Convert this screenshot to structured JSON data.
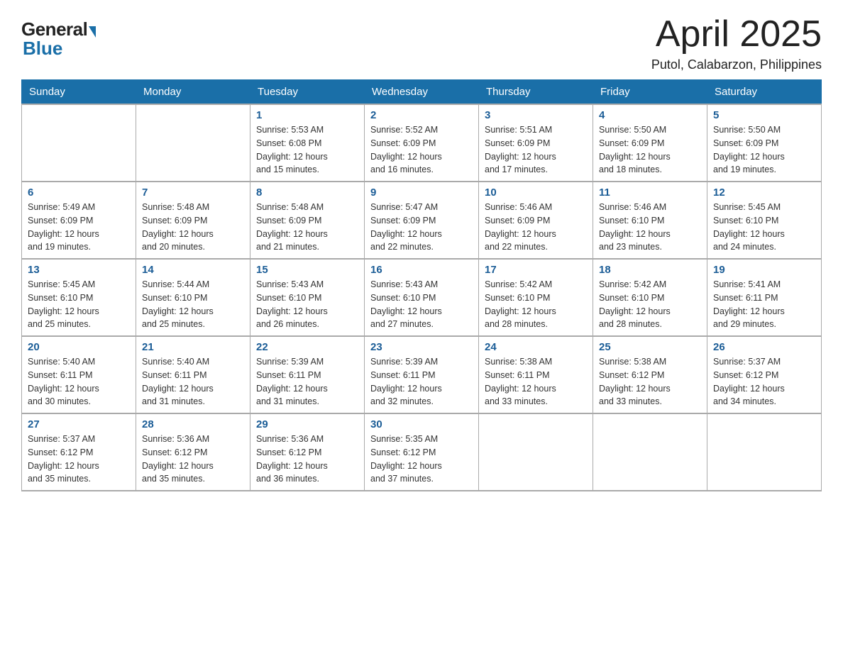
{
  "header": {
    "logo_general": "General",
    "logo_blue": "Blue",
    "month_title": "April 2025",
    "location": "Putol, Calabarzon, Philippines"
  },
  "weekdays": [
    "Sunday",
    "Monday",
    "Tuesday",
    "Wednesday",
    "Thursday",
    "Friday",
    "Saturday"
  ],
  "weeks": [
    [
      {
        "day": "",
        "info": ""
      },
      {
        "day": "",
        "info": ""
      },
      {
        "day": "1",
        "info": "Sunrise: 5:53 AM\nSunset: 6:08 PM\nDaylight: 12 hours\nand 15 minutes."
      },
      {
        "day": "2",
        "info": "Sunrise: 5:52 AM\nSunset: 6:09 PM\nDaylight: 12 hours\nand 16 minutes."
      },
      {
        "day": "3",
        "info": "Sunrise: 5:51 AM\nSunset: 6:09 PM\nDaylight: 12 hours\nand 17 minutes."
      },
      {
        "day": "4",
        "info": "Sunrise: 5:50 AM\nSunset: 6:09 PM\nDaylight: 12 hours\nand 18 minutes."
      },
      {
        "day": "5",
        "info": "Sunrise: 5:50 AM\nSunset: 6:09 PM\nDaylight: 12 hours\nand 19 minutes."
      }
    ],
    [
      {
        "day": "6",
        "info": "Sunrise: 5:49 AM\nSunset: 6:09 PM\nDaylight: 12 hours\nand 19 minutes."
      },
      {
        "day": "7",
        "info": "Sunrise: 5:48 AM\nSunset: 6:09 PM\nDaylight: 12 hours\nand 20 minutes."
      },
      {
        "day": "8",
        "info": "Sunrise: 5:48 AM\nSunset: 6:09 PM\nDaylight: 12 hours\nand 21 minutes."
      },
      {
        "day": "9",
        "info": "Sunrise: 5:47 AM\nSunset: 6:09 PM\nDaylight: 12 hours\nand 22 minutes."
      },
      {
        "day": "10",
        "info": "Sunrise: 5:46 AM\nSunset: 6:09 PM\nDaylight: 12 hours\nand 22 minutes."
      },
      {
        "day": "11",
        "info": "Sunrise: 5:46 AM\nSunset: 6:10 PM\nDaylight: 12 hours\nand 23 minutes."
      },
      {
        "day": "12",
        "info": "Sunrise: 5:45 AM\nSunset: 6:10 PM\nDaylight: 12 hours\nand 24 minutes."
      }
    ],
    [
      {
        "day": "13",
        "info": "Sunrise: 5:45 AM\nSunset: 6:10 PM\nDaylight: 12 hours\nand 25 minutes."
      },
      {
        "day": "14",
        "info": "Sunrise: 5:44 AM\nSunset: 6:10 PM\nDaylight: 12 hours\nand 25 minutes."
      },
      {
        "day": "15",
        "info": "Sunrise: 5:43 AM\nSunset: 6:10 PM\nDaylight: 12 hours\nand 26 minutes."
      },
      {
        "day": "16",
        "info": "Sunrise: 5:43 AM\nSunset: 6:10 PM\nDaylight: 12 hours\nand 27 minutes."
      },
      {
        "day": "17",
        "info": "Sunrise: 5:42 AM\nSunset: 6:10 PM\nDaylight: 12 hours\nand 28 minutes."
      },
      {
        "day": "18",
        "info": "Sunrise: 5:42 AM\nSunset: 6:10 PM\nDaylight: 12 hours\nand 28 minutes."
      },
      {
        "day": "19",
        "info": "Sunrise: 5:41 AM\nSunset: 6:11 PM\nDaylight: 12 hours\nand 29 minutes."
      }
    ],
    [
      {
        "day": "20",
        "info": "Sunrise: 5:40 AM\nSunset: 6:11 PM\nDaylight: 12 hours\nand 30 minutes."
      },
      {
        "day": "21",
        "info": "Sunrise: 5:40 AM\nSunset: 6:11 PM\nDaylight: 12 hours\nand 31 minutes."
      },
      {
        "day": "22",
        "info": "Sunrise: 5:39 AM\nSunset: 6:11 PM\nDaylight: 12 hours\nand 31 minutes."
      },
      {
        "day": "23",
        "info": "Sunrise: 5:39 AM\nSunset: 6:11 PM\nDaylight: 12 hours\nand 32 minutes."
      },
      {
        "day": "24",
        "info": "Sunrise: 5:38 AM\nSunset: 6:11 PM\nDaylight: 12 hours\nand 33 minutes."
      },
      {
        "day": "25",
        "info": "Sunrise: 5:38 AM\nSunset: 6:12 PM\nDaylight: 12 hours\nand 33 minutes."
      },
      {
        "day": "26",
        "info": "Sunrise: 5:37 AM\nSunset: 6:12 PM\nDaylight: 12 hours\nand 34 minutes."
      }
    ],
    [
      {
        "day": "27",
        "info": "Sunrise: 5:37 AM\nSunset: 6:12 PM\nDaylight: 12 hours\nand 35 minutes."
      },
      {
        "day": "28",
        "info": "Sunrise: 5:36 AM\nSunset: 6:12 PM\nDaylight: 12 hours\nand 35 minutes."
      },
      {
        "day": "29",
        "info": "Sunrise: 5:36 AM\nSunset: 6:12 PM\nDaylight: 12 hours\nand 36 minutes."
      },
      {
        "day": "30",
        "info": "Sunrise: 5:35 AM\nSunset: 6:12 PM\nDaylight: 12 hours\nand 37 minutes."
      },
      {
        "day": "",
        "info": ""
      },
      {
        "day": "",
        "info": ""
      },
      {
        "day": "",
        "info": ""
      }
    ]
  ]
}
